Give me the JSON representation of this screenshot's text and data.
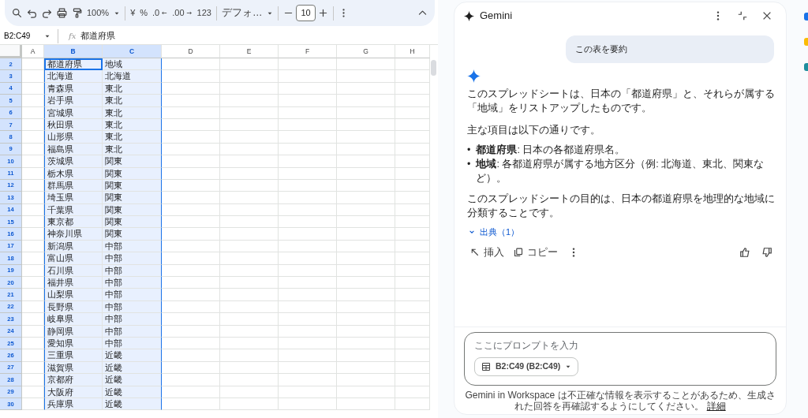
{
  "toolbar": {
    "zoom": "100%",
    "currency": "¥",
    "percent": "%",
    "decrease_decimals": ".0",
    "increase_decimals": ".00",
    "number_format": "123",
    "font": "デフォ…",
    "font_size": "10"
  },
  "sheet": {
    "name_box": "B2:C49",
    "formula_label": "fx",
    "formula": "都道府県",
    "columns": [
      {
        "label": "A",
        "selected": false
      },
      {
        "label": "B",
        "selected": true
      },
      {
        "label": "C",
        "selected": true
      },
      {
        "label": "D",
        "selected": false
      },
      {
        "label": "E",
        "selected": false
      },
      {
        "label": "F",
        "selected": false
      },
      {
        "label": "G",
        "selected": false
      },
      {
        "label": "H",
        "selected": false
      }
    ],
    "rows": [
      {
        "number": "2",
        "selected": true,
        "cursor": true,
        "cells": [
          "都道府県",
          "地域"
        ]
      },
      {
        "number": "3",
        "selected": true,
        "cursor": false,
        "cells": [
          "北海道",
          "北海道"
        ]
      },
      {
        "number": "4",
        "selected": true,
        "cursor": false,
        "cells": [
          "青森県",
          "東北"
        ]
      },
      {
        "number": "5",
        "selected": true,
        "cursor": false,
        "cells": [
          "岩手県",
          "東北"
        ]
      },
      {
        "number": "6",
        "selected": true,
        "cursor": false,
        "cells": [
          "宮城県",
          "東北"
        ]
      },
      {
        "number": "7",
        "selected": true,
        "cursor": false,
        "cells": [
          "秋田県",
          "東北"
        ]
      },
      {
        "number": "8",
        "selected": true,
        "cursor": false,
        "cells": [
          "山形県",
          "東北"
        ]
      },
      {
        "number": "9",
        "selected": true,
        "cursor": false,
        "cells": [
          "福島県",
          "東北"
        ]
      },
      {
        "number": "10",
        "selected": true,
        "cursor": false,
        "cells": [
          "茨城県",
          "関東"
        ]
      },
      {
        "number": "11",
        "selected": true,
        "cursor": false,
        "cells": [
          "栃木県",
          "関東"
        ]
      },
      {
        "number": "12",
        "selected": true,
        "cursor": false,
        "cells": [
          "群馬県",
          "関東"
        ]
      },
      {
        "number": "13",
        "selected": true,
        "cursor": false,
        "cells": [
          "埼玉県",
          "関東"
        ]
      },
      {
        "number": "14",
        "selected": true,
        "cursor": false,
        "cells": [
          "千葉県",
          "関東"
        ]
      },
      {
        "number": "15",
        "selected": true,
        "cursor": false,
        "cells": [
          "東京都",
          "関東"
        ]
      },
      {
        "number": "16",
        "selected": true,
        "cursor": false,
        "cells": [
          "神奈川県",
          "関東"
        ]
      },
      {
        "number": "17",
        "selected": true,
        "cursor": false,
        "cells": [
          "新潟県",
          "中部"
        ]
      },
      {
        "number": "18",
        "selected": true,
        "cursor": false,
        "cells": [
          "富山県",
          "中部"
        ]
      },
      {
        "number": "19",
        "selected": true,
        "cursor": false,
        "cells": [
          "石川県",
          "中部"
        ]
      },
      {
        "number": "20",
        "selected": true,
        "cursor": false,
        "cells": [
          "福井県",
          "中部"
        ]
      },
      {
        "number": "21",
        "selected": true,
        "cursor": false,
        "cells": [
          "山梨県",
          "中部"
        ]
      },
      {
        "number": "22",
        "selected": true,
        "cursor": false,
        "cells": [
          "長野県",
          "中部"
        ]
      },
      {
        "number": "23",
        "selected": true,
        "cursor": false,
        "cells": [
          "岐阜県",
          "中部"
        ]
      },
      {
        "number": "24",
        "selected": true,
        "cursor": false,
        "cells": [
          "静岡県",
          "中部"
        ]
      },
      {
        "number": "25",
        "selected": true,
        "cursor": false,
        "cells": [
          "愛知県",
          "中部"
        ]
      },
      {
        "number": "26",
        "selected": true,
        "cursor": false,
        "cells": [
          "三重県",
          "近畿"
        ]
      },
      {
        "number": "27",
        "selected": true,
        "cursor": false,
        "cells": [
          "滋賀県",
          "近畿"
        ]
      },
      {
        "number": "28",
        "selected": true,
        "cursor": false,
        "cells": [
          "京都府",
          "近畿"
        ]
      },
      {
        "number": "29",
        "selected": true,
        "cursor": false,
        "cells": [
          "大阪府",
          "近畿"
        ]
      },
      {
        "number": "30",
        "selected": true,
        "cursor": false,
        "cells": [
          "兵庫県",
          "近畿"
        ]
      }
    ]
  },
  "gemini": {
    "title": "Gemini",
    "user_message": "この表を要約",
    "response": {
      "intro": "このスプレッドシートは、日本の「都道府県」と、それらが属する「地域」をリストアップしたものです。",
      "lead": "主な項目は以下の通りです。",
      "bullets": [
        {
          "marker": "•",
          "text": "**都道府県**: 日本の各都道府県名。"
        },
        {
          "marker": "•",
          "text": "**地域**: 各都道府県が属する地方区分（例: 北海道、東北、関東など）。"
        }
      ],
      "conclusion": "このスプレッドシートの目的は、日本の都道府県を地理的な地域に分類することです。",
      "sources": "出典（1）",
      "insert": "挿入",
      "copy": "コピー"
    },
    "prompt": {
      "placeholder": "ここにプロンプトを入力",
      "range_chip": "B2:C49 (B2:C49)"
    },
    "disclaimer": "Gemini in Workspace は不正確な情報を表示することがあるため、生成された回答を再確認するようにしてください。",
    "disclaimer_link": "詳細"
  }
}
